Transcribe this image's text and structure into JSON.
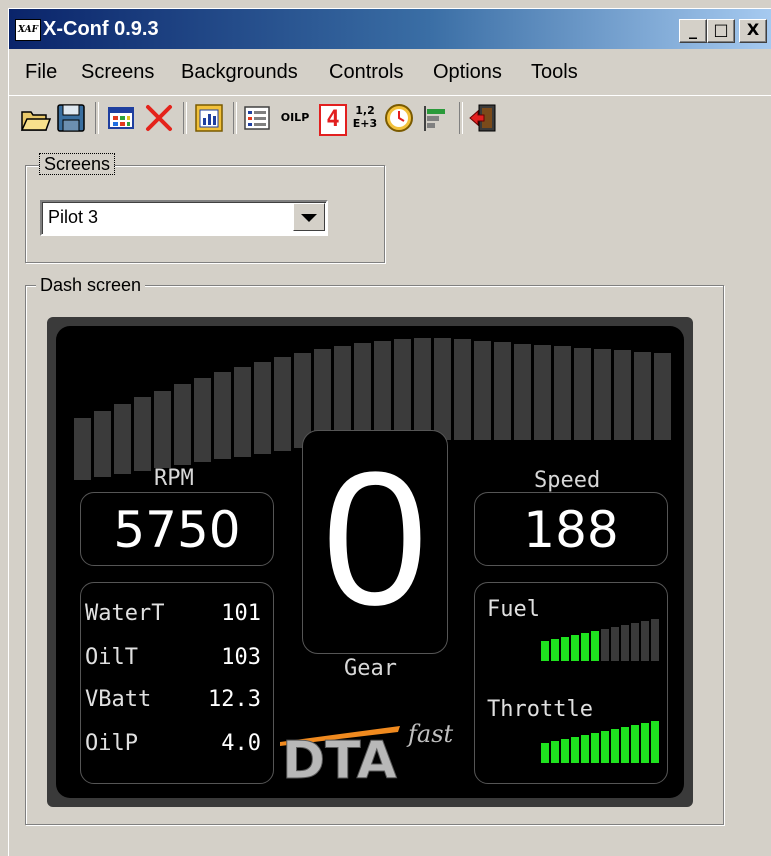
{
  "window": {
    "title": "X-Conf 0.9.3",
    "icon_text": "XAF",
    "minimize": "_",
    "maximize": "□",
    "close": "X"
  },
  "menu": [
    "File",
    "Screens",
    "Backgrounds",
    "Controls",
    "Options",
    "Tools"
  ],
  "toolbar": [
    "open-icon",
    "save-icon",
    "screen-grid-icon",
    "delete-icon",
    "layout-icon",
    "list-icon",
    "oilp-icon",
    "digit-icon",
    "numbers-icon",
    "clock-icon",
    "bars-icon",
    "exit-icon"
  ],
  "toolbar_text": {
    "oilp": "OILP",
    "digit": "4",
    "num_top": "1,2",
    "num_bot": "E+3"
  },
  "screens_group": {
    "label": "Screens",
    "selected": "Pilot 3"
  },
  "dash_group": {
    "label": "Dash screen"
  },
  "dash": {
    "rpm_label": "RPM",
    "rpm_value": "5750",
    "speed_label": "Speed",
    "speed_value": "188",
    "gear_value": "0",
    "gear_label": "Gear",
    "rows": [
      {
        "name": "WaterT",
        "value": "101"
      },
      {
        "name": "OilT",
        "value": "103"
      },
      {
        "name": "VBatt",
        "value": "12.3"
      },
      {
        "name": "OilP",
        "value": "4.0"
      }
    ],
    "fuel_label": "Fuel",
    "throttle_label": "Throttle",
    "fuel_level": 0.5,
    "throttle_level": 1.0,
    "logo_main": "DTA",
    "logo_sub": "fast",
    "colors": {
      "bar_on": "#1fe21f",
      "bar_off": "#3a3a3a",
      "rpm_bar": "#3b3b3b"
    }
  }
}
